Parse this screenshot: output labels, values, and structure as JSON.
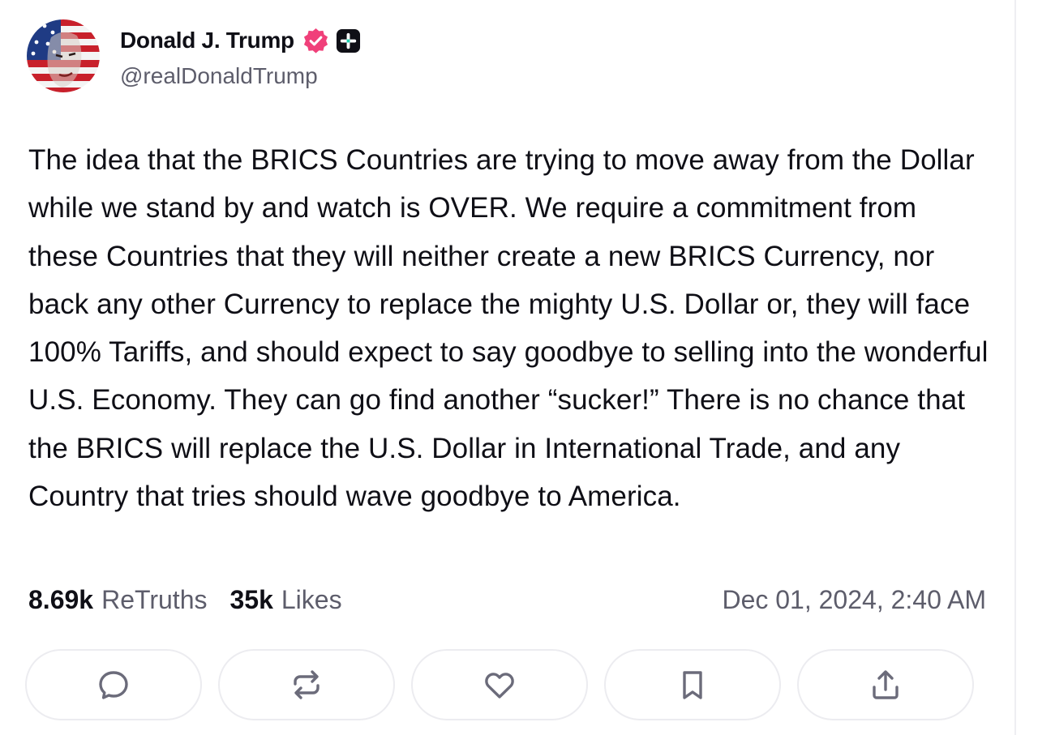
{
  "author": {
    "display_name": "Donald J. Trump",
    "handle": "@realDonaldTrump",
    "avatar_icon": "flag-portrait-avatar",
    "verified_icon": "verified-badge-icon",
    "verified_color": "#f0407a",
    "plus_icon": "plus-badge-icon"
  },
  "post": {
    "text": "The idea that the BRICS Countries are trying to move away from the Dollar while we stand by and watch is OVER. We require a commitment from these Countries that they will neither create a new BRICS Currency, nor back any other Currency to replace the mighty U.S. Dollar or, they will face 100% Tariffs, and should expect to say goodbye to selling into the wonderful U.S. Economy. They can go find another “sucker!” There is no chance that the BRICS will replace the U.S. Dollar in International Trade, and any Country that tries should wave goodbye to America."
  },
  "stats": {
    "retruths_count": "8.69k",
    "retruths_label": "ReTruths",
    "likes_count": "35k",
    "likes_label": "Likes",
    "timestamp": "Dec 01, 2024, 2:40 AM"
  },
  "actions": [
    {
      "icon": "reply-icon"
    },
    {
      "icon": "retruth-icon"
    },
    {
      "icon": "heart-icon"
    },
    {
      "icon": "bookmark-icon"
    },
    {
      "icon": "share-icon"
    }
  ],
  "colors": {
    "text": "#0f0f16",
    "muted": "#5d5d6b",
    "icon": "#6b6b7a",
    "border": "#ececf0"
  }
}
